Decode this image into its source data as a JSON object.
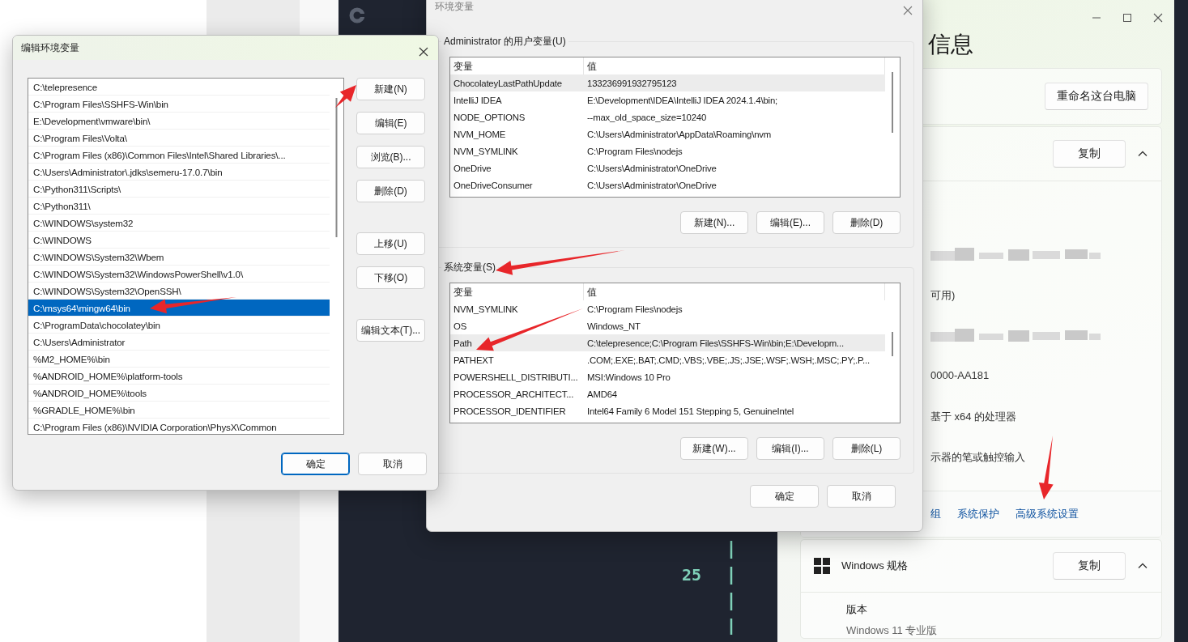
{
  "editor": {
    "line_number": "25"
  },
  "settings_window": {
    "heading": "信息",
    "rename_button": "重命名这台电脑",
    "device_card": {
      "copy_button": "复制",
      "expanded": true,
      "rows": [
        {
          "kind": "redacted"
        },
        {
          "kind": "text",
          "text": "可用)"
        },
        {
          "kind": "redacted"
        },
        {
          "kind": "text",
          "text": "0000-AA181"
        },
        {
          "kind": "text",
          "text": "基于 x64 的处理器"
        },
        {
          "kind": "text",
          "text": "示器的笔或触控输入"
        }
      ],
      "links": [
        "组",
        "系统保护",
        "高级系统设置"
      ]
    },
    "spec_card": {
      "title": "Windows 规格",
      "copy_button": "复制",
      "expanded": true,
      "rows": [
        {
          "label": "版本",
          "value": "Windows 11 专业版"
        }
      ]
    }
  },
  "environment_variables_dialog": {
    "title": "环境变量",
    "groups": [
      {
        "label": "Administrator 的用户变量(U)",
        "columns": [
          "变量",
          "值"
        ],
        "rows": [
          {
            "name": "ChocolateyLastPathUpdate",
            "value": "133236991932795123",
            "selected": true
          },
          {
            "name": "IntelliJ IDEA",
            "value": "E:\\Development\\IDEA\\IntelliJ IDEA 2024.1.4\\bin;",
            "selected": false
          },
          {
            "name": "NODE_OPTIONS",
            "value": "--max_old_space_size=10240",
            "selected": false
          },
          {
            "name": "NVM_HOME",
            "value": "C:\\Users\\Administrator\\AppData\\Roaming\\nvm",
            "selected": false
          },
          {
            "name": "NVM_SYMLINK",
            "value": "C:\\Program Files\\nodejs",
            "selected": false
          },
          {
            "name": "OneDrive",
            "value": "C:\\Users\\Administrator\\OneDrive",
            "selected": false
          },
          {
            "name": "OneDriveConsumer",
            "value": "C:\\Users\\Administrator\\OneDrive",
            "selected": false
          }
        ],
        "buttons": [
          "新建(N)...",
          "编辑(E)...",
          "删除(D)"
        ]
      },
      {
        "label": "系统变量(S)",
        "columns": [
          "变量",
          "值"
        ],
        "rows": [
          {
            "name": "NVM_SYMLINK",
            "value": "C:\\Program Files\\nodejs",
            "selected": false
          },
          {
            "name": "OS",
            "value": "Windows_NT",
            "selected": false
          },
          {
            "name": "Path",
            "value": "C:\\telepresence;C:\\Program Files\\SSHFS-Win\\bin;E:\\Developm...",
            "selected": true
          },
          {
            "name": "PATHEXT",
            "value": ".COM;.EXE;.BAT;.CMD;.VBS;.VBE;.JS;.JSE;.WSF;.WSH;.MSC;.PY;.P...",
            "selected": false
          },
          {
            "name": "POWERSHELL_DISTRIBUTI...",
            "value": "MSI:Windows 10 Pro",
            "selected": false
          },
          {
            "name": "PROCESSOR_ARCHITECT...",
            "value": "AMD64",
            "selected": false
          },
          {
            "name": "PROCESSOR_IDENTIFIER",
            "value": "Intel64 Family 6 Model 151 Stepping 5, GenuineIntel",
            "selected": false
          }
        ],
        "buttons": [
          "新建(W)...",
          "编辑(I)...",
          "删除(L)"
        ]
      }
    ],
    "footer_buttons": [
      {
        "label": "确定",
        "default": false
      },
      {
        "label": "取消",
        "default": false
      }
    ]
  },
  "edit_dialog": {
    "title": "编辑环境变量",
    "entries": [
      {
        "text": "C:\\telepresence",
        "selected": false
      },
      {
        "text": "C:\\Program Files\\SSHFS-Win\\bin",
        "selected": false
      },
      {
        "text": "E:\\Development\\vmware\\bin\\",
        "selected": false
      },
      {
        "text": "C:\\Program Files\\Volta\\",
        "selected": false
      },
      {
        "text": "C:\\Program Files (x86)\\Common Files\\Intel\\Shared Libraries\\...",
        "selected": false
      },
      {
        "text": "C:\\Users\\Administrator\\.jdks\\semeru-17.0.7\\bin",
        "selected": false
      },
      {
        "text": "C:\\Python311\\Scripts\\",
        "selected": false
      },
      {
        "text": "C:\\Python311\\",
        "selected": false
      },
      {
        "text": "C:\\WINDOWS\\system32",
        "selected": false
      },
      {
        "text": "C:\\WINDOWS",
        "selected": false
      },
      {
        "text": "C:\\WINDOWS\\System32\\Wbem",
        "selected": false
      },
      {
        "text": "C:\\WINDOWS\\System32\\WindowsPowerShell\\v1.0\\",
        "selected": false
      },
      {
        "text": "C:\\WINDOWS\\System32\\OpenSSH\\",
        "selected": false
      },
      {
        "text": "C:\\msys64\\mingw64\\bin",
        "selected": true
      },
      {
        "text": "C:\\ProgramData\\chocolatey\\bin",
        "selected": false
      },
      {
        "text": "C:\\Users\\Administrator",
        "selected": false
      },
      {
        "text": "%M2_HOME%\\bin",
        "selected": false
      },
      {
        "text": "%ANDROID_HOME%\\platform-tools",
        "selected": false
      },
      {
        "text": "%ANDROID_HOME%\\tools",
        "selected": false
      },
      {
        "text": "%GRADLE_HOME%\\bin",
        "selected": false
      },
      {
        "text": "C:\\Program Files (x86)\\NVIDIA Corporation\\PhysX\\Common",
        "selected": false
      }
    ],
    "button_groups": [
      [
        "新建(N)",
        "编辑(E)",
        "浏览(B)...",
        "删除(D)"
      ],
      [
        "上移(U)",
        "下移(O)"
      ],
      [
        "编辑文本(T)..."
      ]
    ],
    "footer_buttons": [
      {
        "label": "确定",
        "default": true
      },
      {
        "label": "取消",
        "default": false
      }
    ]
  }
}
